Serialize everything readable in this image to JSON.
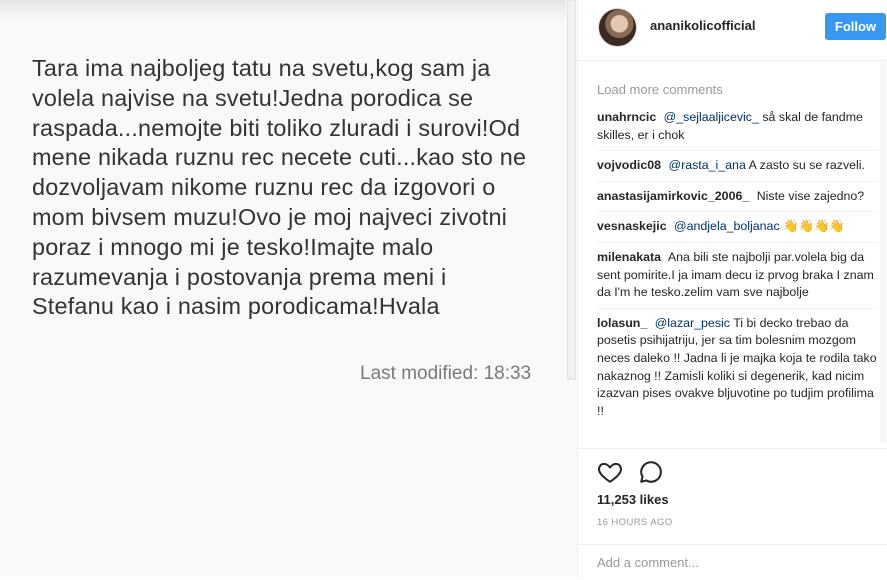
{
  "note": {
    "lines": [
      "Tara ima najboljeg tatu na svetu,kog sam ja",
      "volela najvise na svetu!Jedna porodica se",
      "raspada...nemojte biti toliko zluradi i surovi!Od",
      "mene nikada ruznu rec necete cuti...kao sto ne",
      "dozvoljavam nikome ruznu rec da izgovori o",
      "mom bivsem muzu!Ovo je moj najveci zivotni",
      "poraz i mnogo mi je tesko!Imajte malo",
      "razumevanja i postovanja prema meni i",
      "Stefanu kao i nasim porodicama!Hvala"
    ],
    "modified": "Last modified: 18:33"
  },
  "header": {
    "username": "ananikolicofficial",
    "follow_label": "Follow"
  },
  "comments": {
    "load_more": "Load more comments",
    "items": [
      {
        "user": "unahrncic",
        "mention": "@_sejlaaljicevic_",
        "text": " så skal de fandme skilles, er i chok"
      },
      {
        "user": "vojvodic08",
        "mention": "@rasta_i_ana",
        "text": " A zasto su se razveli."
      },
      {
        "user": "anastasijamirkovic_2006_",
        "mention": "",
        "text": "Niste vise zajedno?"
      },
      {
        "user": "vesnaskejic",
        "mention": "@andjela_boljanac",
        "text": " 👋👋👋👋"
      },
      {
        "user": "milenakata",
        "mention": "",
        "text": "Ana bili ste najbolji par.volela big da sent pomirite.I ja imam decu iz prvog braka I znam da I'm he tesko.zelim vam sve najbolje"
      },
      {
        "user": "lolasun_",
        "mention": "@lazar_pesic",
        "text": " Ti bi decko trebao da posetis psihijatriju, jer sa tim bolesnim mozgom neces daleko !! Jadna li je majka koja te rodila tako nakaznog !! Zamisli koliki si degenerik, kad nicim izazvan pises ovakve bljuvotine po tudjim profilima !!"
      }
    ]
  },
  "actions": {
    "like_icon": "heart-outline-icon",
    "comment_icon": "speech-bubble-icon",
    "likes": "11,253 likes",
    "timestamp": "16 HOURS AGO",
    "add_comment_placeholder": "Add a comment..."
  },
  "colors": {
    "follow_button": "#3897f0",
    "mention": "#003569",
    "muted": "#999999"
  }
}
